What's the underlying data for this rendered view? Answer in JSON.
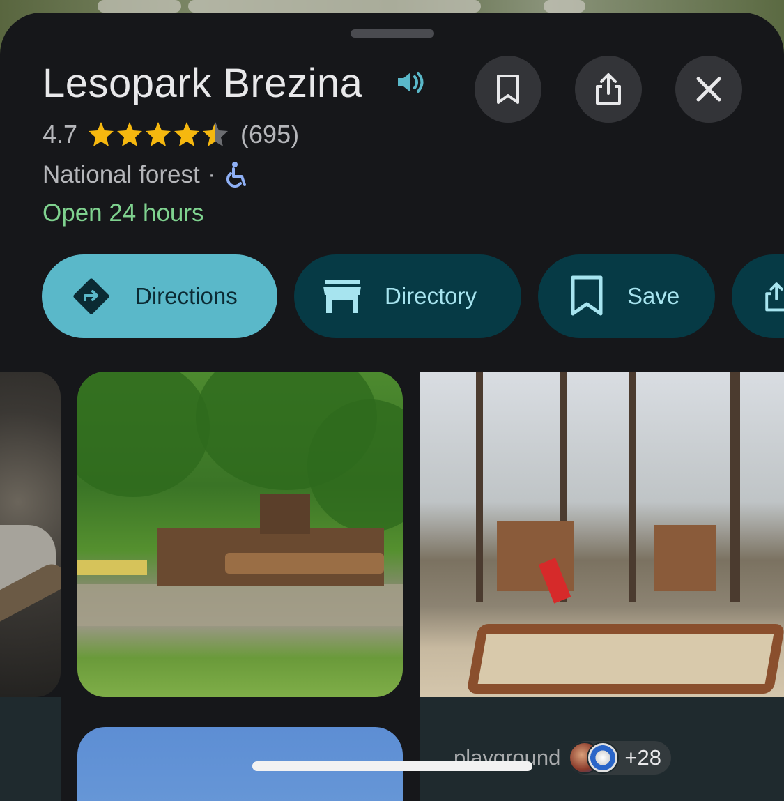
{
  "place": {
    "title": "Lesopark Brezina",
    "rating": "4.7",
    "stars_value": 4.7,
    "reviews": "(695)",
    "category": "National forest",
    "separator": "·",
    "hours": "Open 24 hours"
  },
  "header_buttons": {
    "save_icon": "bookmark-icon",
    "share_icon": "share-icon",
    "close_icon": "close-icon"
  },
  "actions": [
    {
      "label": "Directions",
      "icon": "directions-icon"
    },
    {
      "label": "Directory",
      "icon": "storefront-icon"
    },
    {
      "label": "Save",
      "icon": "bookmark-icon"
    }
  ],
  "photos": {
    "tag_label": "playground",
    "contributors_count": "+28"
  },
  "colors": {
    "accent_primary": "#5ab8c9",
    "chip_secondary": "#063a45",
    "open_green": "#7fd28f",
    "star": "#f6b80f",
    "sheet_bg": "#16171a"
  }
}
